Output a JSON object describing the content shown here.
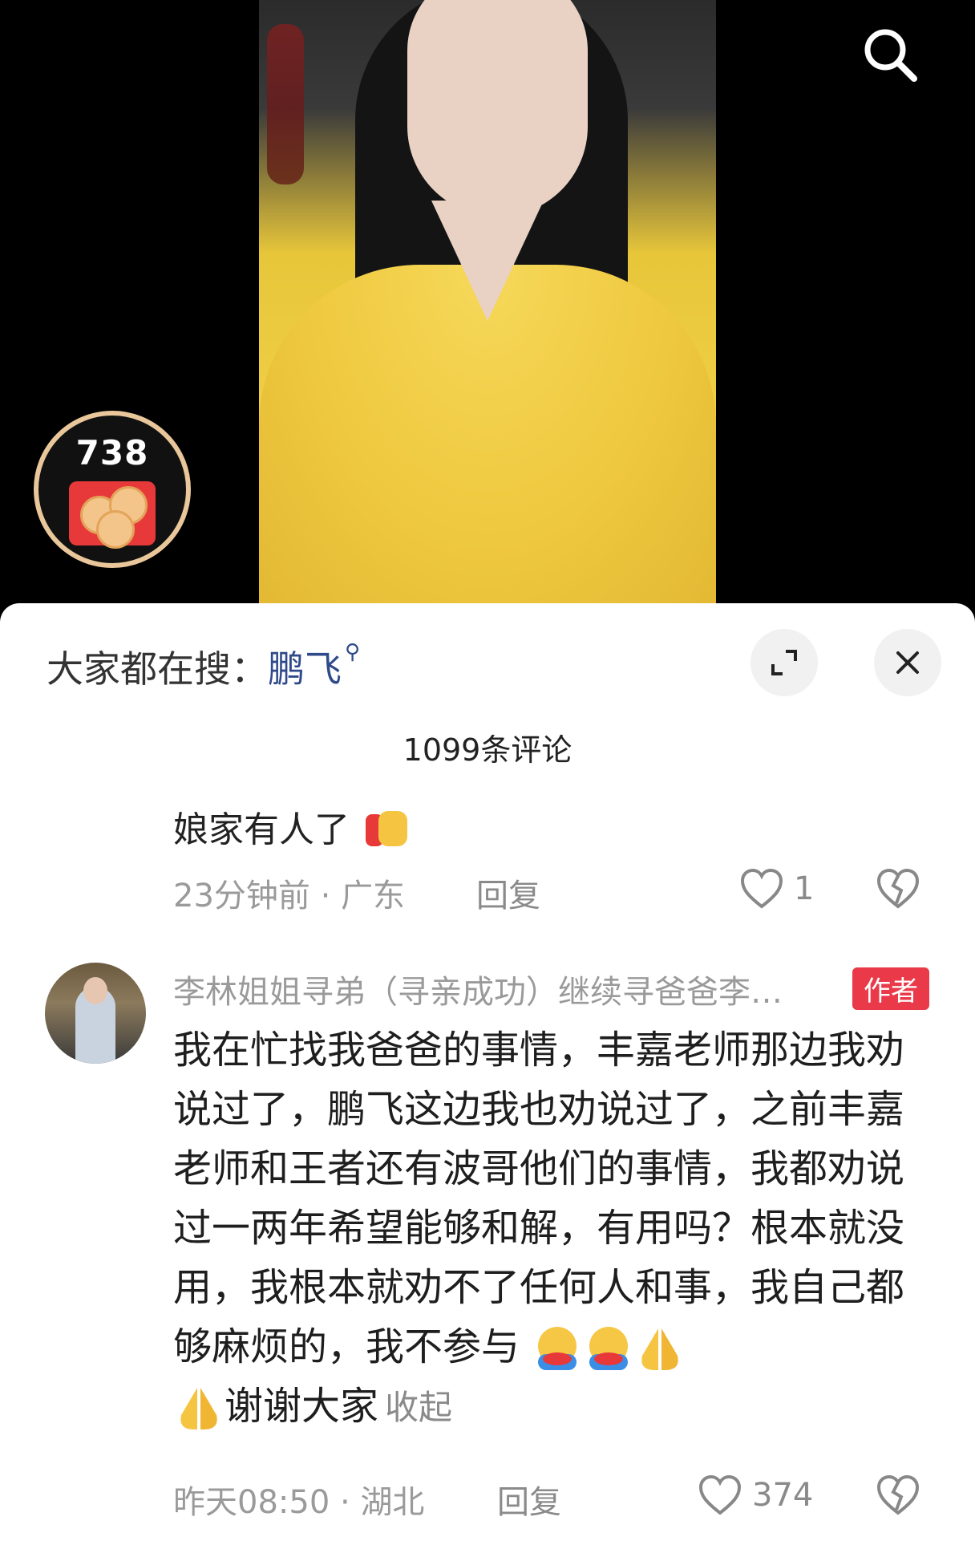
{
  "video": {
    "reward_count": "738"
  },
  "search": {
    "prefix": "大家都在搜：",
    "keyword": "鹏飞"
  },
  "comments": {
    "count_label": "1099条评论",
    "items": [
      {
        "text": "娘家有人了",
        "emoji": "fist-icon",
        "time": "23分钟前",
        "sep": "·",
        "location": "广东",
        "reply": "回复",
        "likes": "1"
      },
      {
        "author": "李林姐姐寻弟（寻亲成功）继续寻爸爸李…",
        "badge": "作者",
        "text": "我在忙找我爸爸的事情，丰嘉老师那边我劝说过了，鹏飞这边我也劝说过了，之前丰嘉老师和王者还有波哥他们的事情，我都劝说过一两年希望能够和解，有用吗？根本就没用，我根本就劝不了任何人和事，我自己都够麻烦的，我不参与",
        "text_tail": "谢谢大家",
        "collapse": "收起",
        "time": "昨天08:50",
        "sep": "·",
        "location": "湖北",
        "reply": "回复",
        "likes": "374"
      }
    ]
  },
  "colors": {
    "keyword": "#2f4a8a",
    "badge": "#ea3a4a",
    "muted": "#9a9a9a"
  }
}
